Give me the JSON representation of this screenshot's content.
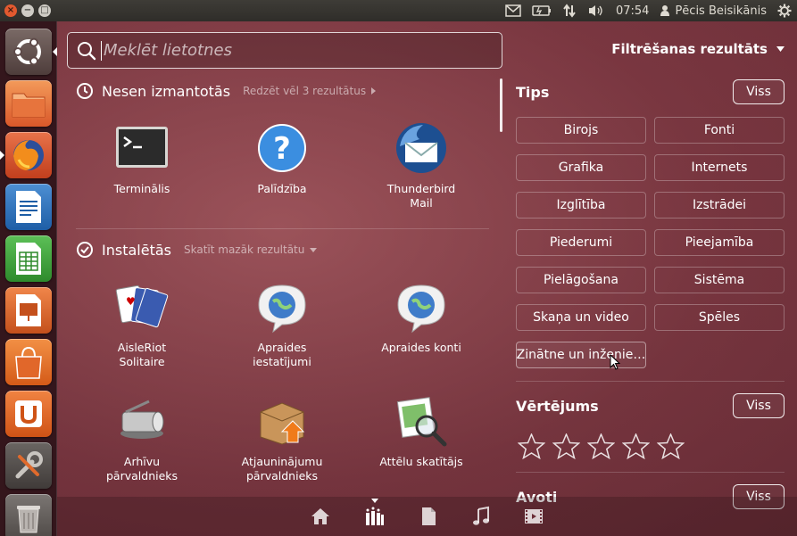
{
  "top_panel": {
    "clock": "07:54",
    "user": "Pēcis Beisikānis",
    "indicators": [
      "mail-icon",
      "battery-icon",
      "network-icon",
      "volume-icon"
    ]
  },
  "launcher": {
    "items": [
      {
        "name": "dash-home",
        "icon": "ubuntu-logo-icon"
      },
      {
        "name": "files",
        "icon": "folder-icon"
      },
      {
        "name": "firefox",
        "icon": "firefox-icon"
      },
      {
        "name": "writer",
        "icon": "libreoffice-writer-icon"
      },
      {
        "name": "calc",
        "icon": "libreoffice-calc-icon"
      },
      {
        "name": "impress",
        "icon": "libreoffice-impress-icon"
      },
      {
        "name": "software-center",
        "icon": "shopping-bag-icon"
      },
      {
        "name": "ubuntu-one",
        "icon": "ubuntu-one-icon"
      },
      {
        "name": "system-settings",
        "icon": "wrench-icon"
      },
      {
        "name": "trash",
        "icon": "trash-icon"
      }
    ]
  },
  "search": {
    "placeholder": "Meklēt lietotnes",
    "value": ""
  },
  "filter_toggle": {
    "label": "Filtrēšanas rezultāts"
  },
  "recent": {
    "title": "Nesen izmantotās",
    "more": "Redzēt vēl 3 rezultātus",
    "apps": [
      {
        "label": "Terminālis",
        "icon": "terminal-icon"
      },
      {
        "label": "Palīdzība",
        "icon": "help-icon"
      },
      {
        "label": "Thunderbird Mail",
        "icon": "thunderbird-icon"
      }
    ]
  },
  "installed": {
    "title": "Instalētās",
    "more": "Skatīt mazāk rezultātu",
    "apps": [
      {
        "label": "AisleRiot Solitaire",
        "icon": "cards-icon"
      },
      {
        "label": "Apraides iestatījumi",
        "icon": "globe-bubble-icon"
      },
      {
        "label": "Apraides konti",
        "icon": "globe-bubble-icon"
      },
      {
        "label": "Arhīvu pārvaldnieks",
        "icon": "archive-icon"
      },
      {
        "label": "Atjaunināju­mu pārvaldnieks",
        "icon": "package-update-icon"
      },
      {
        "label": "Attēlu skatītājs",
        "icon": "image-viewer-icon"
      }
    ]
  },
  "filters": {
    "tips": {
      "title": "Tips",
      "all_label": "Viss",
      "options": [
        "Birojs",
        "Fonti",
        "Grafika",
        "Internets",
        "Izglītība",
        "Izstrādei",
        "Piederumi",
        "Pieejamība",
        "Pielāgošana",
        "Sistēma",
        "Skaņa un video",
        "Spēles",
        "Zinātne un inženie…"
      ]
    },
    "rating": {
      "title": "Vērtējums",
      "all_label": "Viss",
      "stars": 5
    },
    "sources": {
      "title": "Avoti",
      "all_label": "Viss"
    }
  },
  "lens_bar": {
    "lenses": [
      "home-icon",
      "applications-icon",
      "files-icon",
      "music-icon",
      "video-icon"
    ],
    "active": "applications-icon"
  }
}
